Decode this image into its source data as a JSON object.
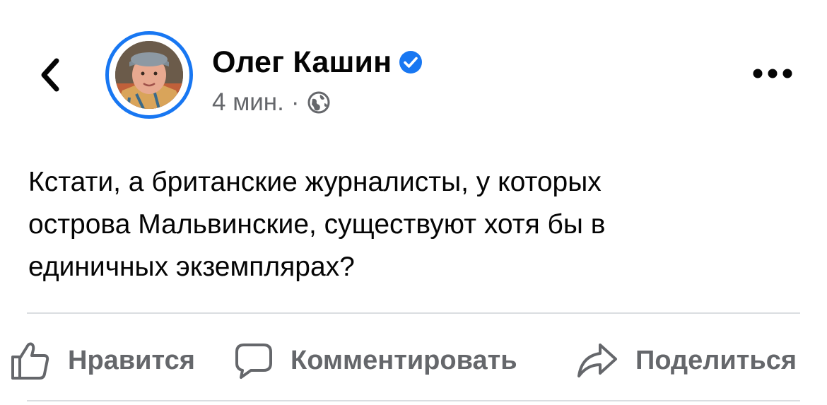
{
  "header": {
    "author_name": "Олег Кашин",
    "timestamp": "4 мин.",
    "separator": "·",
    "verified": true,
    "privacy_icon": "globe-icon",
    "back_icon": "chevron-left-icon",
    "more_icon": "more-dots-icon"
  },
  "post": {
    "lines": [
      "Кстати, а британские журналисты, у которых",
      "острова Мальвинские, существуют хотя бы в",
      "единичных экземплярах?"
    ]
  },
  "actions": {
    "like_label": "Нравится",
    "comment_label": "Комментировать",
    "share_label": "Поделиться"
  },
  "colors": {
    "accent": "#1877f2",
    "secondary_text": "#65676b",
    "divider": "#dadde1"
  }
}
